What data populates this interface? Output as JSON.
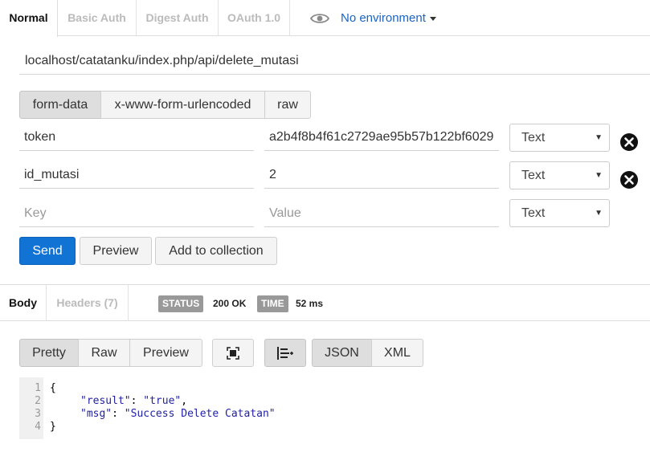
{
  "auth_tabs": [
    "Normal",
    "Basic Auth",
    "Digest Auth",
    "OAuth 1.0"
  ],
  "environment": {
    "icon": "eye-icon",
    "label": "No environment"
  },
  "url": "localhost/catatanku/index.php/api/delete_mutasi",
  "body_types": [
    "form-data",
    "x-www-form-urlencoded",
    "raw"
  ],
  "params": [
    {
      "key": "token",
      "value": "a2b4f8b4f61c2729ae95b57b122bf6029",
      "type": "Text"
    },
    {
      "key": "id_mutasi",
      "value": "2",
      "type": "Text"
    }
  ],
  "new_param": {
    "key_placeholder": "Key",
    "value_placeholder": "Value",
    "type": "Text"
  },
  "actions": {
    "send": "Send",
    "preview": "Preview",
    "add_to_collection": "Add to collection"
  },
  "response": {
    "tabs": [
      "Body",
      "Headers (7)"
    ],
    "status_label": "STATUS",
    "status_value": "200 OK",
    "time_label": "TIME",
    "time_value": "52 ms",
    "view_modes": [
      "Pretty",
      "Raw",
      "Preview"
    ],
    "formats": [
      "JSON",
      "XML"
    ]
  },
  "code": {
    "line_numbers": [
      "1",
      "2",
      "3",
      "4"
    ],
    "open_brace": "{",
    "close_brace": "}",
    "entries": [
      {
        "key": "\"result\"",
        "value": "\"true\"",
        "sep": ": ",
        "trail": ","
      },
      {
        "key": "\"msg\"",
        "value": "\"Success Delete Catatan\"",
        "sep": ": ",
        "trail": ""
      }
    ]
  },
  "colors": {
    "accent": "#1174d5",
    "link": "#1a63c4",
    "badge": "#999999",
    "code_key": "#1f1fa6"
  }
}
